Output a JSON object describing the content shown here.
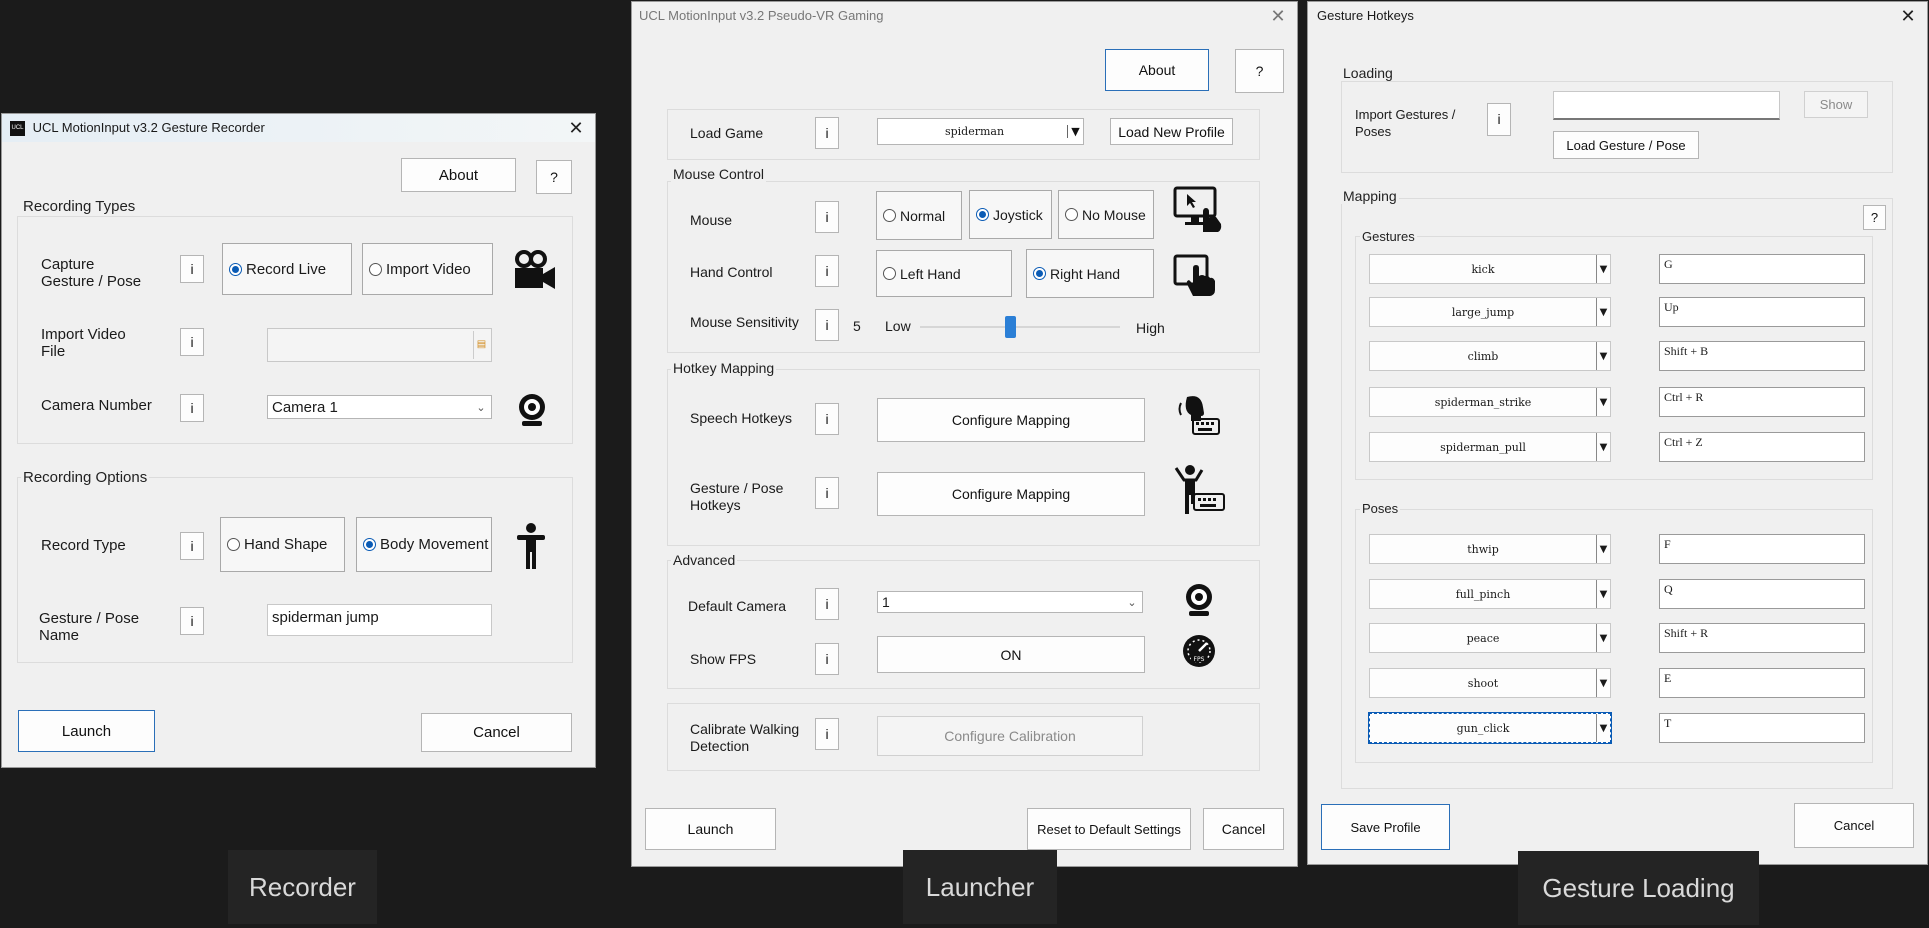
{
  "recorder": {
    "title": "UCL MotionInput v3.2 Gesture Recorder",
    "app_icon_text": "UCL",
    "about_label": "About",
    "help_label": "?",
    "info_label": "i",
    "recording_types_title": "Recording Types",
    "capture_label": "Capture\nGesture / Pose",
    "record_live_label": "Record Live",
    "import_video_label": "Import Video",
    "import_file_label": "Import Video\nFile",
    "camera_number_label": "Camera Number",
    "camera_value": "Camera 1",
    "recording_options_title": "Recording Options",
    "record_type_label": "Record Type",
    "hand_shape_label": "Hand Shape",
    "body_movement_label": "Body Movement",
    "gesture_name_label": "Gesture / Pose\nName",
    "gesture_name_value": "spiderman jump",
    "launch_label": "Launch",
    "cancel_label": "Cancel"
  },
  "launcher": {
    "title": "UCL MotionInput v3.2 Pseudo-VR Gaming",
    "about_label": "About",
    "help_label": "?",
    "info_label": "i",
    "load_game_label": "Load Game",
    "game_value": "spiderman",
    "load_profile_label": "Load New Profile",
    "mouse_control_title": "Mouse Control",
    "mouse_label": "Mouse",
    "normal_label": "Normal",
    "joystick_label": "Joystick",
    "no_mouse_label": "No Mouse",
    "hand_control_label": "Hand Control",
    "left_hand_label": "Left Hand",
    "right_hand_label": "Right Hand",
    "sensitivity_label": "Mouse Sensitivity",
    "sensitivity_value": "5",
    "sensitivity_fraction": 0.45,
    "low_label": "Low",
    "high_label": "High",
    "hotkey_mapping_title": "Hotkey Mapping",
    "speech_hotkeys_label": "Speech Hotkeys",
    "configure_mapping_label": "Configure Mapping",
    "gesture_hotkeys_label": "Gesture / Pose\nHotkeys",
    "configure_mapping_label_2": "Configure Mapping",
    "advanced_title": "Advanced",
    "default_camera_label": "Default Camera",
    "default_camera_value": "1",
    "show_fps_label": "Show FPS",
    "show_fps_value": "ON",
    "calibrate_label": "Calibrate Walking\nDetection",
    "configure_calibration_label": "Configure Calibration",
    "launch_label": "Launch",
    "reset_label": "Reset to Default Settings",
    "cancel_label": "Cancel"
  },
  "hotkeys": {
    "title": "Gesture Hotkeys",
    "loading_title": "Loading",
    "import_label": "Import Gestures /\nPoses",
    "info_label": "i",
    "show_label": "Show",
    "load_gesture_label": "Load Gesture / Pose",
    "mapping_title": "Mapping",
    "help_label": "?",
    "gestures_title": "Gestures",
    "poses_title": "Poses",
    "gestures": [
      {
        "name": "kick",
        "key": "G"
      },
      {
        "name": "large_jump",
        "key": "Up"
      },
      {
        "name": "climb",
        "key": "Shift + B"
      },
      {
        "name": "spiderman_strike",
        "key": "Ctrl + R"
      },
      {
        "name": "spiderman_pull",
        "key": "Ctrl + Z"
      }
    ],
    "poses": [
      {
        "name": "thwip",
        "key": "F"
      },
      {
        "name": "full_pinch",
        "key": "Q"
      },
      {
        "name": "peace",
        "key": "Shift + R"
      },
      {
        "name": "shoot",
        "key": "E"
      },
      {
        "name": "gun_click",
        "key": "T"
      }
    ],
    "save_label": "Save Profile",
    "cancel_label": "Cancel"
  },
  "captions": {
    "recorder": "Recorder",
    "launcher": "Launcher",
    "gesture_loading": "Gesture Loading"
  },
  "colors": {
    "background": "#1b1b1b",
    "window": "#f0f0f0",
    "accent": "#0a5bb5",
    "slider": "#2b7fd6"
  }
}
